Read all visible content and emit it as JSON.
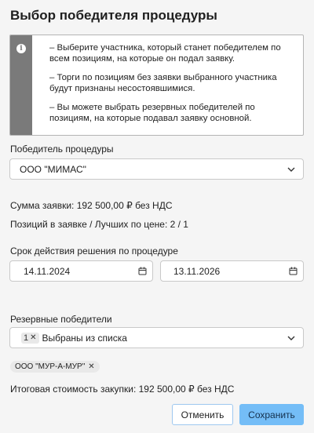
{
  "dialog": {
    "title": "Выбор победителя процедуры"
  },
  "info": {
    "lines": [
      "– Выберите участника, который станет победителем по всем позициям, на которые он подал заявку.",
      "– Торги по позициям без заявки выбранного участника будут признаны несостоявшимися.",
      "– Вы можете выбрать резервных победителей по позициям, на которые подавал заявку основной."
    ]
  },
  "winner": {
    "label": "Победитель процедуры",
    "value": "ООО \"МИМАС\""
  },
  "summary": {
    "bid_amount": "Сумма заявки: 192 500,00 ₽ без НДС",
    "positions": "Позиций в заявке / Лучших по цене: 2 / 1"
  },
  "validity": {
    "label": "Срок действия решения по процедуре",
    "date_from": "14.11.2024",
    "date_to": "13.11.2026"
  },
  "reserve": {
    "label": "Резервные победители",
    "selected_count": "1",
    "selected_text": "Выбраны из списка",
    "tags": [
      "ООО \"МУР-А-МУР\""
    ]
  },
  "total": "Итоговая стоимость закупки: 192 500,00 ₽ без НДС",
  "buttons": {
    "cancel": "Отменить",
    "save": "Сохранить"
  },
  "colors": {
    "accent": "#74bdf7",
    "info_stripe": "#7a7a7a",
    "background": "#f5f5f5"
  }
}
